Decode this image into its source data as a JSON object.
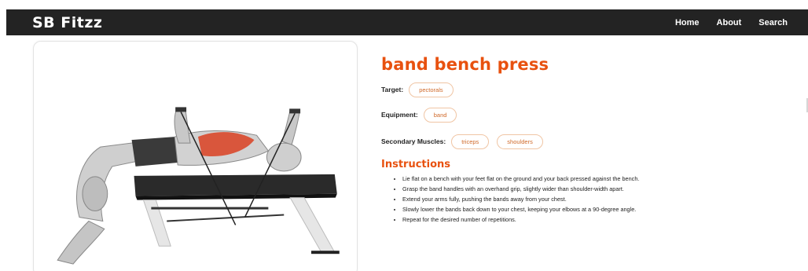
{
  "navbar": {
    "brand": "SB Fitzz",
    "links": [
      "Home",
      "About",
      "Search"
    ]
  },
  "exercise": {
    "title": "band bench press",
    "target_label": "Target:",
    "target": "pectorals",
    "equipment_label": "Equipment:",
    "equipment": "band",
    "secondary_label": "Secondary Muscles:",
    "secondary_muscles": [
      "triceps",
      "shoulders"
    ],
    "image_icon": "exercise-illustration"
  },
  "instructions": {
    "heading": "Instructions",
    "steps": [
      "Lie flat on a bench with your feet flat on the ground and your back pressed against the bench.",
      "Grasp the band handles with an overhand grip, slightly wider than shoulder-width apart.",
      "Extend your arms fully, pushing the bands away from your chest.",
      "Slowly lower the bands back down to your chest, keeping your elbows at a 90-degree angle.",
      "Repeat for the desired number of repetitions."
    ]
  },
  "colors": {
    "accent": "#e8510f",
    "navbar": "#232323",
    "chip_border": "#f0c5a4",
    "chip_text": "#d06a2a",
    "muscle_highlight": "#d9482b"
  }
}
